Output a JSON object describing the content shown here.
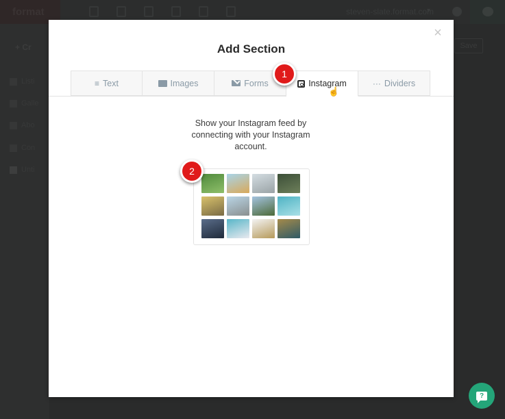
{
  "app": {
    "brand": "format",
    "site_selector": "steven-slate.format.com",
    "top_icons": [
      "pages-icon",
      "gallery-icon",
      "theme-icon",
      "blog-icon",
      "store-icon",
      "settings-icon"
    ],
    "sidebar": {
      "create_label": "+ Cr",
      "items": [
        {
          "label": "Listi"
        },
        {
          "label": "Galle"
        },
        {
          "label": "Abo"
        },
        {
          "label": "Con"
        },
        {
          "label": "Unti"
        }
      ]
    },
    "save_label": "Save"
  },
  "modal": {
    "title": "Add Section",
    "close_icon": "×",
    "tabs": [
      {
        "label": "Text",
        "icon": "≡",
        "active": false
      },
      {
        "label": "Images",
        "icon": "image-icon",
        "active": false
      },
      {
        "label": "Forms",
        "icon": "mail-icon",
        "active": false
      },
      {
        "label": "Instagram",
        "icon": "instagram-icon",
        "active": true
      },
      {
        "label": "Dividers",
        "icon": "···",
        "active": false
      }
    ],
    "description": "Show your Instagram feed by connecting with your Instagram account.",
    "preview_thumbs": [
      {
        "name": "leaf",
        "colors": [
          "#4f8a3c",
          "#8fbf6a"
        ]
      },
      {
        "name": "beach",
        "colors": [
          "#a8d4e8",
          "#d9a95a"
        ]
      },
      {
        "name": "pier",
        "colors": [
          "#d4dde2",
          "#9aa3a6"
        ]
      },
      {
        "name": "cliffs",
        "colors": [
          "#3c4f38",
          "#6d7f5a"
        ]
      },
      {
        "name": "lemon-drink",
        "colors": [
          "#d9c26b",
          "#7a6b45"
        ]
      },
      {
        "name": "seagull",
        "colors": [
          "#b9d5e6",
          "#8a8f8f"
        ]
      },
      {
        "name": "palms",
        "colors": [
          "#a4c3e0",
          "#4d6a38"
        ]
      },
      {
        "name": "aerial-sea",
        "colors": [
          "#4fb3c4",
          "#a9e0e6"
        ]
      },
      {
        "name": "dark-hills",
        "colors": [
          "#5a6d8a",
          "#1f2a3a"
        ]
      },
      {
        "name": "pool",
        "colors": [
          "#58b6c8",
          "#e9e9ef"
        ]
      },
      {
        "name": "chair",
        "colors": [
          "#f3f3f3",
          "#b69a5a"
        ]
      },
      {
        "name": "coast",
        "colors": [
          "#a58a4a",
          "#2e5a66"
        ]
      }
    ]
  },
  "annotations": [
    {
      "label": "1"
    },
    {
      "label": "2"
    }
  ],
  "help_chat": {
    "icon": "?",
    "color": "#24a579"
  }
}
